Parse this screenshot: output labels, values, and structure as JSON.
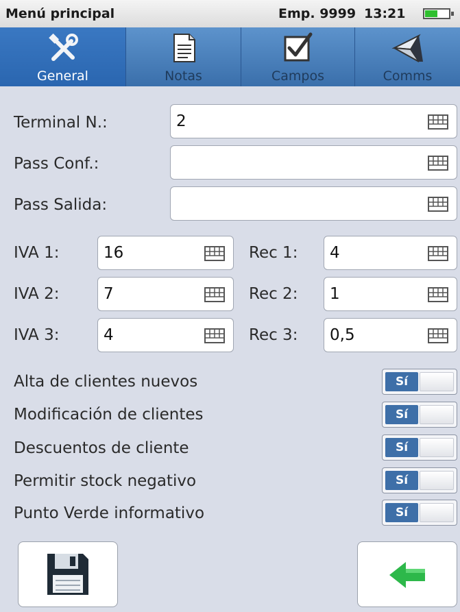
{
  "status": {
    "title": "Menú principal",
    "company": "Emp. 9999",
    "time": "13:21",
    "battery_level": 0.5,
    "battery_icon": "battery-icon"
  },
  "tabs": [
    {
      "label": "General",
      "icon": "tools-icon",
      "active": true
    },
    {
      "label": "Notas",
      "icon": "document-icon",
      "active": false
    },
    {
      "label": "Campos",
      "icon": "checkbox-icon",
      "active": false
    },
    {
      "label": "Comms",
      "icon": "antenna-icon",
      "active": false
    }
  ],
  "fields": {
    "terminal": {
      "label": "Terminal N.:",
      "value": "2"
    },
    "pass_conf": {
      "label": "Pass Conf.:",
      "value": ""
    },
    "pass_salida": {
      "label": "Pass Salida:",
      "value": ""
    }
  },
  "taxes": [
    {
      "iva_label": "IVA 1:",
      "iva_value": "16",
      "rec_label": "Rec 1:",
      "rec_value": "4"
    },
    {
      "iva_label": "IVA 2:",
      "iva_value": "7",
      "rec_label": "Rec 2:",
      "rec_value": "1"
    },
    {
      "iva_label": "IVA 3:",
      "iva_value": "4",
      "rec_label": "Rec 3:",
      "rec_value": "0,5"
    }
  ],
  "options": [
    {
      "label": "Alta de clientes nuevos",
      "state": "Sí"
    },
    {
      "label": "Modificación de clientes",
      "state": "Sí"
    },
    {
      "label": "Descuentos de cliente",
      "state": "Sí"
    },
    {
      "label": "Permitir stock negativo",
      "state": "Sí"
    },
    {
      "label": "Punto Verde informativo",
      "state": "Sí"
    }
  ],
  "buttons": {
    "save_icon": "save-icon",
    "back_icon": "back-arrow-icon"
  },
  "colors": {
    "tab_active": "#2a66b0",
    "switch_on": "#3e6fa8",
    "back_arrow": "#2db84a"
  }
}
